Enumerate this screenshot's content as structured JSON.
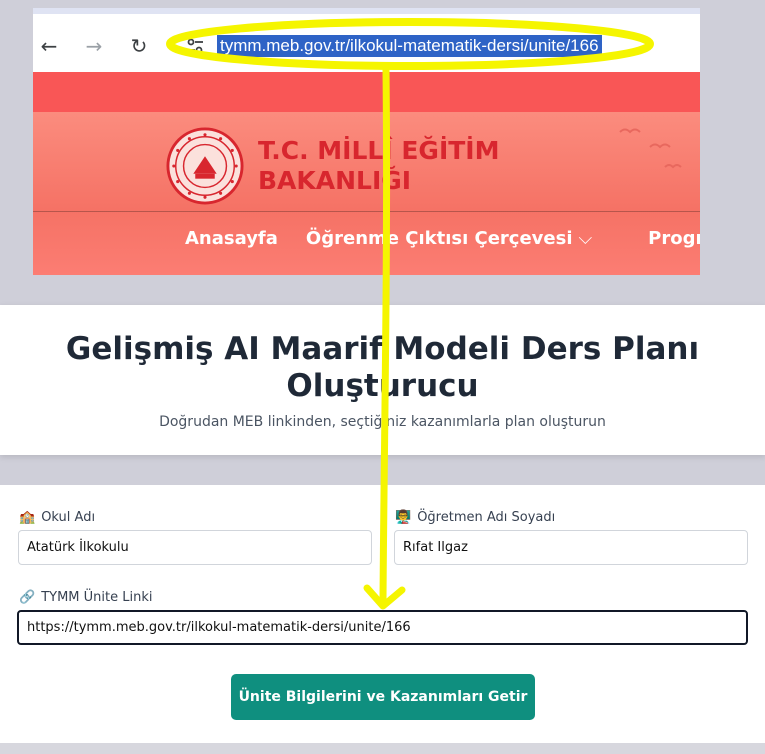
{
  "browser": {
    "url": "tymm.meb.gov.tr/ilkokul-matematik-dersi/unite/166"
  },
  "site": {
    "ministry_line1": "T.C. MİLLÎ EĞİTİM",
    "ministry_line2": "BAKANLIĞI",
    "menu": [
      "Anasayfa",
      "Öğrenme Çıktısı Çerçevesi",
      "Programlar Arası"
    ]
  },
  "app": {
    "title_line1": "Gelişmiş AI Maarif Modeli Ders Planı",
    "title_line2": "Oluşturucu",
    "subtitle": "Doğrudan MEB linkinden, seçtiğiniz kazanımlarla plan oluşturun"
  },
  "form": {
    "school_label": "Okul Adı",
    "school_value": "Atatürk İlkokulu",
    "teacher_label": "Öğretmen Adı Soyadı",
    "teacher_value": "Rıfat Ilgaz",
    "link_label": "TYMM Ünite Linki",
    "link_value": "https://tymm.meb.gov.tr/ilkokul-matematik-dersi/unite/166",
    "submit_label": "Ünite Bilgilerini ve Kazanımları Getir"
  },
  "colors": {
    "accent": "#0f8f7f",
    "ministry_red": "#d8262e",
    "annotation": "#f5f500"
  },
  "icons": {
    "school": "school-icon",
    "teacher": "teacher-icon",
    "link": "link-icon"
  }
}
